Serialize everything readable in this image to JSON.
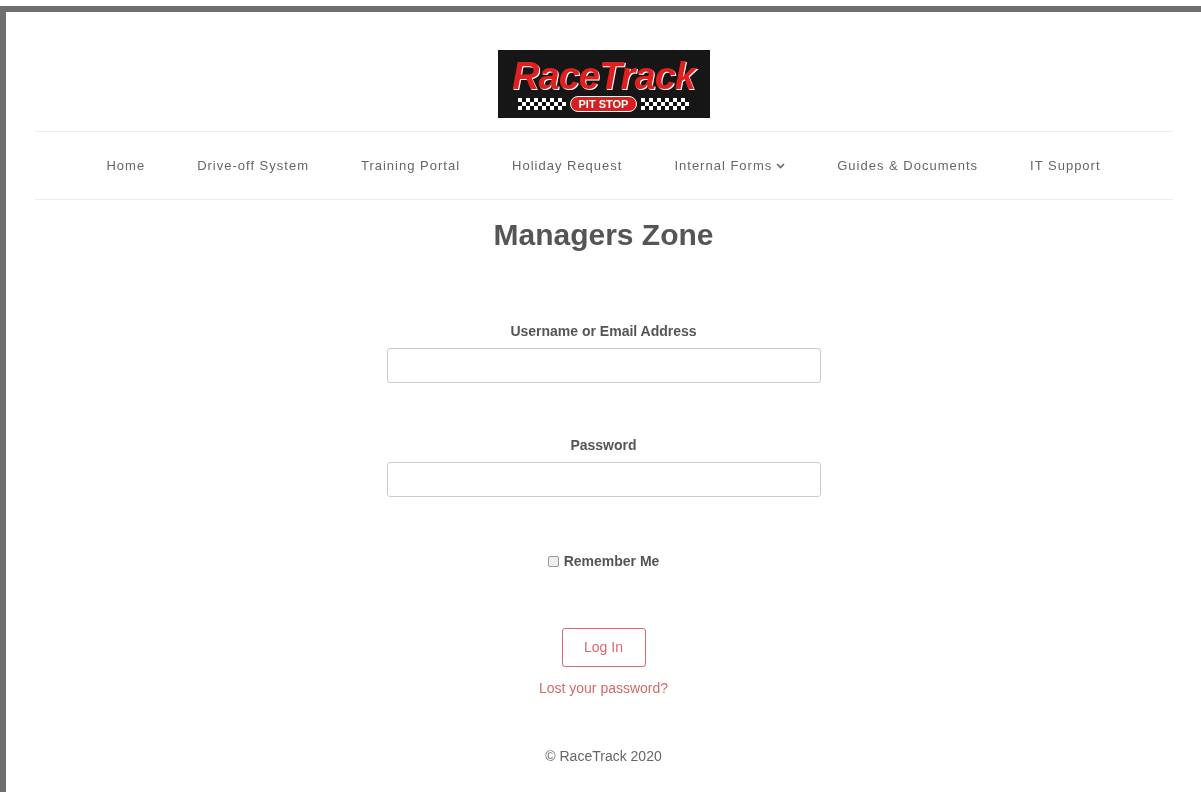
{
  "logo": {
    "title": "RaceTrack",
    "subtitle": "PIT STOP"
  },
  "nav": [
    {
      "label": "Home",
      "dropdown": false
    },
    {
      "label": "Drive-off System",
      "dropdown": false
    },
    {
      "label": "Training Portal",
      "dropdown": false
    },
    {
      "label": "Holiday Request",
      "dropdown": false
    },
    {
      "label": "Internal Forms",
      "dropdown": true
    },
    {
      "label": "Guides & Documents",
      "dropdown": false
    },
    {
      "label": "IT Support",
      "dropdown": false
    }
  ],
  "heading": "Managers Zone",
  "form": {
    "fields": [
      {
        "label": "Username or Email Address"
      },
      {
        "label": "Password"
      }
    ],
    "remember": {
      "label": "Remember Me",
      "checked": false
    },
    "submit": "Log In",
    "lost_password": "Lost your password?"
  },
  "footer": "© RaceTrack 2020"
}
